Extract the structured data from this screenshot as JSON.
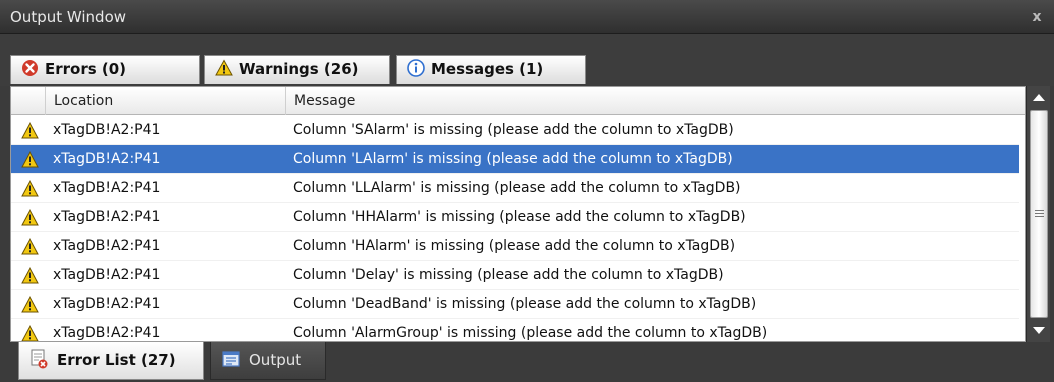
{
  "window": {
    "title": "Output Window",
    "close_glyph": "x"
  },
  "tabs": [
    {
      "label": "Errors (0)",
      "icon": "error-icon"
    },
    {
      "label": "Warnings (26)",
      "icon": "warning-icon"
    },
    {
      "label": "Messages (1)",
      "icon": "info-icon"
    }
  ],
  "grid": {
    "columns": [
      "Location",
      "Message"
    ],
    "rows": [
      {
        "location": "xTagDB!A2:P41",
        "message": "Column 'SAlarm' is missing (please add the column to xTagDB)"
      },
      {
        "location": "xTagDB!A2:P41",
        "message": "Column 'LAlarm' is missing (please add the column to xTagDB)"
      },
      {
        "location": "xTagDB!A2:P41",
        "message": "Column 'LLAlarm' is missing (please add the column to xTagDB)"
      },
      {
        "location": "xTagDB!A2:P41",
        "message": "Column 'HHAlarm' is missing (please add the column to xTagDB)"
      },
      {
        "location": "xTagDB!A2:P41",
        "message": "Column 'HAlarm' is missing (please add the column to xTagDB)"
      },
      {
        "location": "xTagDB!A2:P41",
        "message": "Column 'Delay' is missing (please add the column to xTagDB)"
      },
      {
        "location": "xTagDB!A2:P41",
        "message": "Column 'DeadBand' is missing (please add the column to xTagDB)"
      },
      {
        "location": "xTagDB!A2:P41",
        "message": "Column 'AlarmGroup' is missing (please add the column to xTagDB)"
      }
    ],
    "selected_index": 1
  },
  "bottom_tabs": [
    {
      "label": "Error List (27)",
      "icon": "error-list-icon"
    },
    {
      "label": "Output",
      "icon": "output-icon"
    }
  ],
  "colors": {
    "selection": "#3a73c6",
    "error": "#d03a2a",
    "warning": "#f2c811",
    "info": "#2f6fd0"
  }
}
